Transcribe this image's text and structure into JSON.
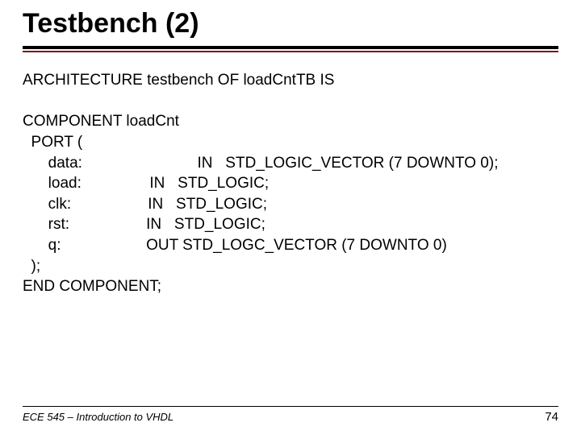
{
  "title": "Testbench (2)",
  "arch_line": "ARCHITECTURE testbench OF loadCntTB IS",
  "comp_line": "COMPONENT loadCnt",
  "port_open": "  PORT (",
  "ports": {
    "data": "      data:                           IN   STD_LOGIC_VECTOR (7 DOWNTO 0);",
    "load": "      load:                IN   STD_LOGIC;",
    "clk": "      clk:                  IN   STD_LOGIC;",
    "rst": "      rst:                  IN   STD_LOGIC;",
    "q": "      q:                    OUT STD_LOGC_VECTOR (7 DOWNTO 0)"
  },
  "port_close": "  );",
  "end_comp": "END COMPONENT;",
  "footer": {
    "left": "ECE 545 – Introduction to VHDL",
    "page": "74"
  }
}
